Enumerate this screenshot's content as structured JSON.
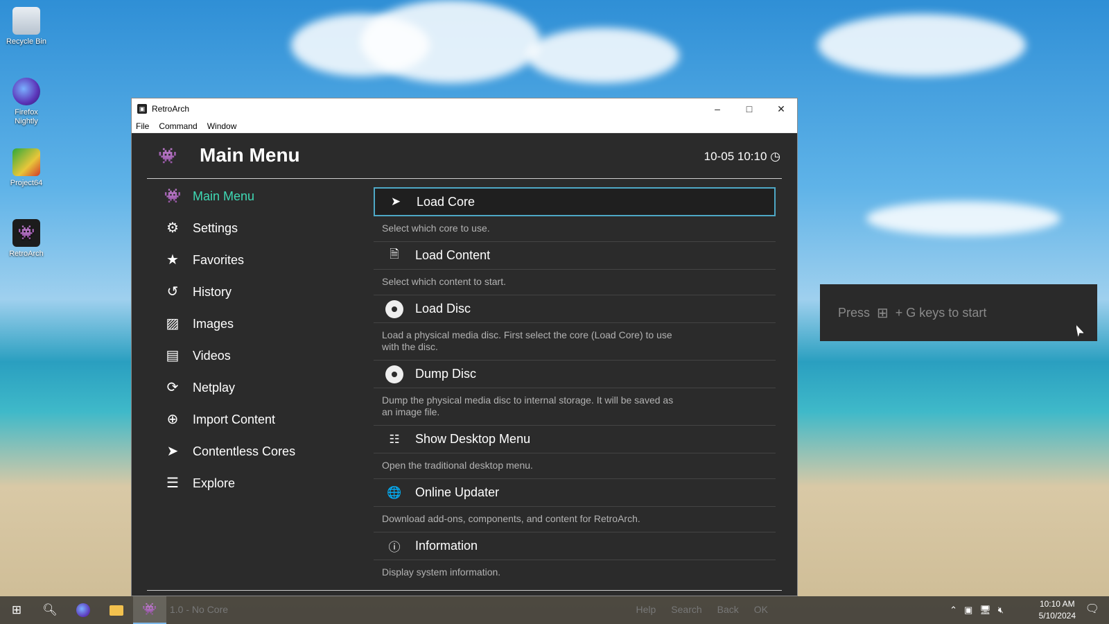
{
  "desktop": {
    "icons": [
      {
        "label": "Recycle Bin"
      },
      {
        "label": "Firefox Nightly"
      },
      {
        "label": "Project64"
      },
      {
        "label": "RetroArch"
      }
    ]
  },
  "window": {
    "title": "RetroArch",
    "menus": [
      "File",
      "Command",
      "Window"
    ]
  },
  "retroarch": {
    "header_title": "Main Menu",
    "clock": "10-05 10:10",
    "sidebar": [
      {
        "label": "Main Menu",
        "icon": "invader-icon",
        "active": true
      },
      {
        "label": "Settings",
        "icon": "gear-icon"
      },
      {
        "label": "Favorites",
        "icon": "star-icon"
      },
      {
        "label": "History",
        "icon": "history-icon"
      },
      {
        "label": "Images",
        "icon": "image-icon"
      },
      {
        "label": "Videos",
        "icon": "film-icon"
      },
      {
        "label": "Netplay",
        "icon": "netplay-icon"
      },
      {
        "label": "Import Content",
        "icon": "plus-circle-icon"
      },
      {
        "label": "Contentless Cores",
        "icon": "rocket-icon"
      },
      {
        "label": "Explore",
        "icon": "database-icon"
      }
    ],
    "entries": [
      {
        "label": "Load Core",
        "desc": "Select which core to use.",
        "icon": "rocket-icon"
      },
      {
        "label": "Load Content",
        "desc": "Select which content to start.",
        "icon": "file-icon"
      },
      {
        "label": "Load Disc",
        "desc": "Load a physical media disc. First select the core (Load Core) to use with the disc.",
        "icon": "disc-icon"
      },
      {
        "label": "Dump Disc",
        "desc": "Dump the physical media disc to internal storage. It will be saved as an image file.",
        "icon": "disc-icon"
      },
      {
        "label": "Show Desktop Menu",
        "desc": "Open the traditional desktop menu.",
        "icon": "list-icon"
      },
      {
        "label": "Online Updater",
        "desc": "Download add-ons, components, and content for RetroArch.",
        "icon": "globe-icon"
      },
      {
        "label": "Information",
        "desc": "Display system information.",
        "icon": "info-icon"
      }
    ],
    "footer": {
      "core": "1.0 - No Core",
      "help": "Help",
      "search": "Search",
      "back": "Back",
      "ok": "OK"
    }
  },
  "gamebar_hint": {
    "press": "Press",
    "suffix": "+ G keys to start"
  },
  "taskbar": {
    "time": "10:10 AM",
    "date": "5/10/2024"
  }
}
